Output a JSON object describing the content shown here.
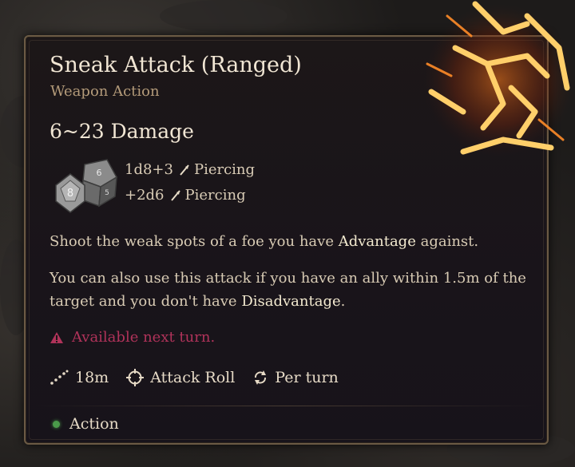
{
  "tooltip": {
    "title": "Sneak Attack (Ranged)",
    "subtitle": "Weapon Action",
    "damage_range": "6~23 Damage",
    "dice_faces": [
      "6",
      "8",
      "5"
    ],
    "damage_lines": [
      {
        "dice": "1d8+3",
        "type": "Piercing"
      },
      {
        "dice": "+2d6",
        "type": "Piercing"
      }
    ],
    "description_1": {
      "before": "Shoot the weak spots of a foe you have ",
      "keyword": "Advantage",
      "after": " against."
    },
    "description_2": {
      "before": "You can also use this attack if you have an ally within 1.5m of the target and you don't have ",
      "keyword": "Disadvantage",
      "after": "."
    },
    "warning": "Available next turn.",
    "stats": {
      "range": "18m",
      "roll": "Attack Roll",
      "cooldown": "Per turn"
    },
    "resource": "Action"
  },
  "icons": {
    "emblem": "sneak-attack-icon",
    "dice": "dice-icon",
    "damage_type": "piercing-arrow-icon",
    "warning": "warning-triangle-icon",
    "range": "range-dots-icon",
    "attack_roll": "target-crosshair-icon",
    "cooldown": "cycle-arrows-icon",
    "resource": "action-dot-icon"
  },
  "colors": {
    "accent_fire": "#f29a2e",
    "warning": "#b0335a",
    "action_green": "#4a9a4a",
    "frame": "#6b5a44"
  }
}
